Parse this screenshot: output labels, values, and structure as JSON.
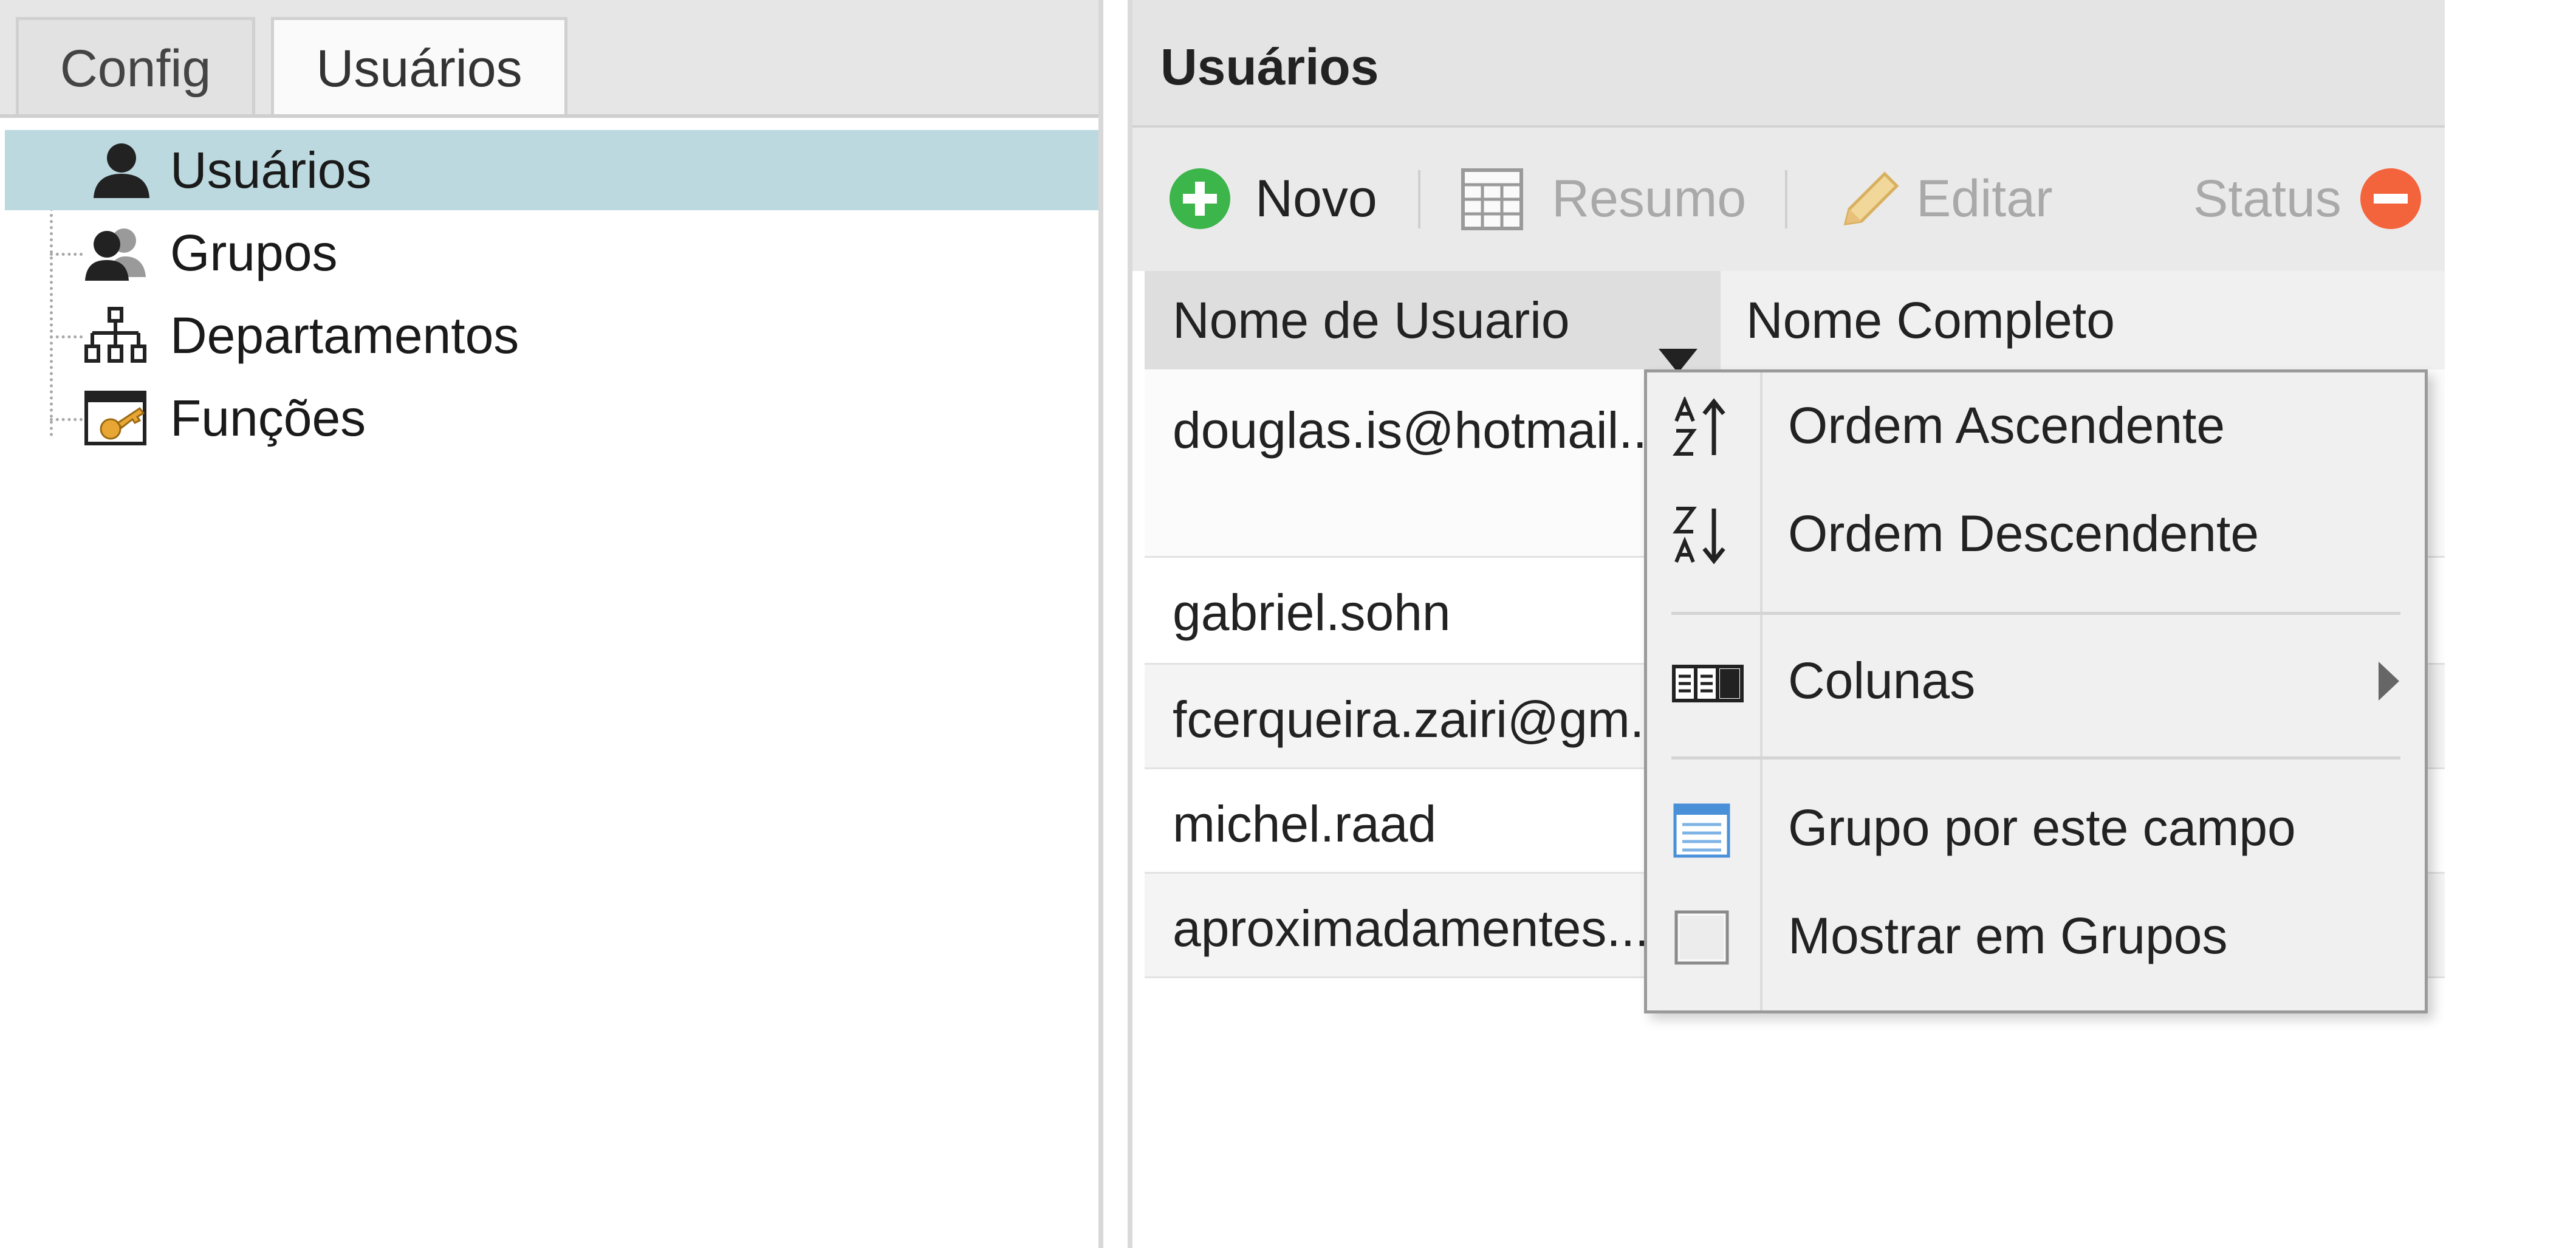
{
  "left_panel": {
    "tabs": [
      {
        "label": "Config",
        "active": false
      },
      {
        "label": "Usuários",
        "active": true
      }
    ],
    "tree": [
      {
        "label": "Usuários",
        "icon": "user-icon",
        "selected": true
      },
      {
        "label": "Grupos",
        "icon": "group-icon",
        "selected": false
      },
      {
        "label": "Departamentos",
        "icon": "org-chart-icon",
        "selected": false
      },
      {
        "label": "Funções",
        "icon": "key-window-icon",
        "selected": false
      }
    ]
  },
  "right_panel": {
    "title": "Usuários",
    "toolbar": {
      "new_label": "Novo",
      "summary_label": "Resumo",
      "edit_label": "Editar",
      "status_label": "Status"
    },
    "columns": [
      "Nome de Usuario",
      "Nome Completo"
    ],
    "rows": [
      {
        "username": "douglas.is@hotmail..."
      },
      {
        "username": "gabriel.sohn"
      },
      {
        "username": "fcerqueira.zairi@gm..."
      },
      {
        "username": "michel.raad"
      },
      {
        "username": "aproximadamentes..."
      }
    ]
  },
  "context_menu": {
    "items": [
      {
        "label": "Ordem Ascendente",
        "icon": "sort-ascending-icon"
      },
      {
        "label": "Ordem Descendente",
        "icon": "sort-descending-icon"
      },
      {
        "label": "Colunas",
        "icon": "columns-icon",
        "submenu": true
      },
      {
        "label": "Grupo por este campo",
        "icon": "group-by-icon"
      },
      {
        "label": "Mostrar em Grupos",
        "icon": "checkbox-icon",
        "checked": false
      }
    ]
  },
  "colors": {
    "selected_row": "#bcd9e0",
    "new_button": "#3cb54a",
    "status_button": "#f4643c"
  }
}
